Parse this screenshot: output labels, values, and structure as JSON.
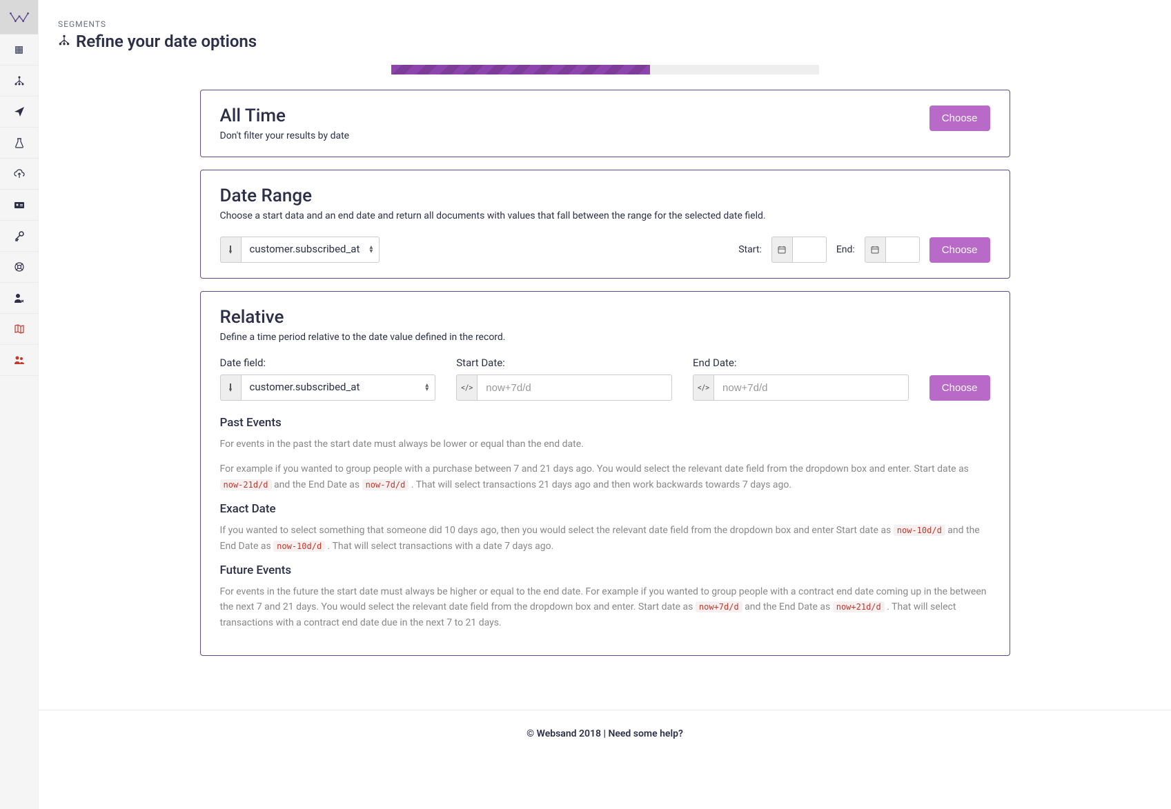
{
  "breadcrumb": "SEGMENTS",
  "page_title": "Refine your date options",
  "progress_percent": 60.5,
  "cards": {
    "all_time": {
      "title": "All Time",
      "subtitle": "Don't filter your results by date",
      "button": "Choose"
    },
    "date_range": {
      "title": "Date Range",
      "subtitle": "Choose a start data and an end date and return all documents with values that fall between the range for the selected date field.",
      "field_select": "customer.subscribed_at",
      "start_label": "Start:",
      "end_label": "End:",
      "button": "Choose"
    },
    "relative": {
      "title": "Relative",
      "subtitle": "Define a time period relative to the date value defined in the record.",
      "date_field_label": "Date field:",
      "date_field_value": "customer.subscribed_at",
      "start_date_label": "Start Date:",
      "start_date_placeholder": "now+7d/d",
      "end_date_label": "End Date:",
      "end_date_placeholder": "now+7d/d",
      "button": "Choose",
      "past_events_h": "Past Events",
      "past_events_p1": "For events in the past the start date must always be lower or equal than the end date.",
      "past_events_p2a": "For example if you wanted to group people with a purchase between 7 and 21 days ago. You would select the relevant date field from the dropdown box and enter. Start date as ",
      "past_events_code1": "now-21d/d",
      "past_events_p2b": " and the End Date as ",
      "past_events_code2": "now-7d/d",
      "past_events_p2c": " . That will select transactions 21 days ago and then work backwards towards 7 days ago.",
      "exact_date_h": "Exact Date",
      "exact_date_p1a": "If you wanted to select something that someone did 10 days ago, then you would select the relevant date field from the dropdown box and enter Start date as ",
      "exact_date_code1": "now-10d/d",
      "exact_date_p1b": " and the End Date as ",
      "exact_date_code2": "now-10d/d",
      "exact_date_p1c": " . That will select transactions with a date 7 days ago.",
      "future_events_h": "Future Events",
      "future_events_p1a": "For events in the future the start date must always be higher or equal to the end date. For example if you wanted to group people with a contract end date coming up in the between the next 7 and 21 days. You would select the relevant date field from the dropdown box and enter. Start date as ",
      "future_events_code1": "now+7d/d",
      "future_events_p1b": " and the End Date as ",
      "future_events_code2": "now+21d/d",
      "future_events_p1c": " . That will select transactions with a contract end date due in the next 7 to 21 days."
    }
  },
  "footer": "© Websand 2018 | Need some help?"
}
